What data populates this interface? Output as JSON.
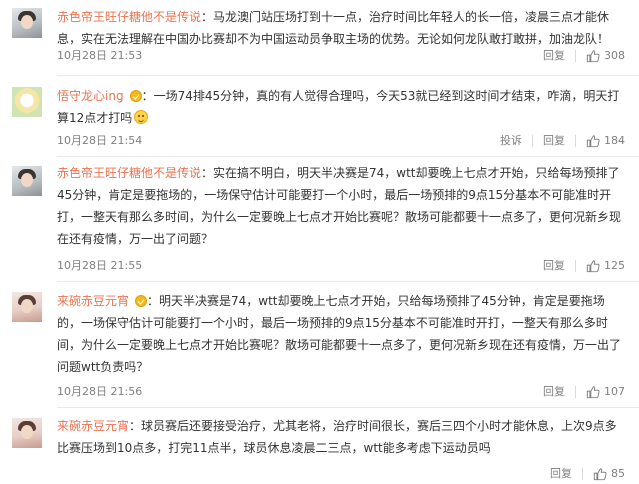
{
  "comments": [
    {
      "username": "赤色帝王旺仔糖他不是传说",
      "text": "：马龙澳门站压场打到十一点，治疗时间比年轻人的长一倍，凌晨三点才能休息，实在无法理解在中国办比赛却不为中国运动员争取主场的优势。无论如何龙队敢打敢拼，加油龙队！",
      "time": "10月28日 21:53",
      "report": "",
      "reply": "回复",
      "likes": "308"
    },
    {
      "username": "悟守龙心ing",
      "text": "：一场74排45分钟，真的有人觉得合理吗，今天53就已经到这时间才结束，咋滴，明天打算12点才打吗",
      "time": "10月28日 21:54",
      "report": "投诉",
      "reply": "回复",
      "likes": "184"
    },
    {
      "username": "赤色帝王旺仔糖他不是传说",
      "text": "：实在搞不明白，明天半决赛是74，wtt却要晚上七点才开始，只给每场预排了45分钟，肯定是要拖场的，一场保守估计可能要打一个小时，最后一场预排的9点15分基本不可能准时开打，一整天有那么多时间，为什么一定要晚上七点才开始比赛呢？散场可能都要十一点多了，更何况新乡现在还有疫情，万一出了问题？",
      "time": "10月28日 21:55",
      "report": "",
      "reply": "回复",
      "likes": "125"
    },
    {
      "username": "来碗赤豆元宵",
      "text": "：明天半决赛是74，wtt却要晚上七点才开始，只给每场预排了45分钟，肯定是要拖场的，一场保守估计可能要打一个小时，最后一场预排的9点15分基本不可能准时开打，一整天有那么多时间，为什么一定要晚上七点才开始比赛呢？散场可能都要十一点多了，更何况新乡现在还有疫情，万一出了问题wtt负责吗？",
      "time": "10月28日 21:56",
      "report": "",
      "reply": "回复",
      "likes": "107"
    },
    {
      "username": "来碗赤豆元宵",
      "text": "：球员赛后还要接受治疗，尤其老将，治疗时间很长，赛后三四个小时才能休息，上次9点多比赛压场到10点多，打完11点半，球员休息凌晨二三点，wtt能多考虑下运动员吗",
      "time": "",
      "report": "",
      "reply": "回复",
      "likes": "85"
    }
  ]
}
